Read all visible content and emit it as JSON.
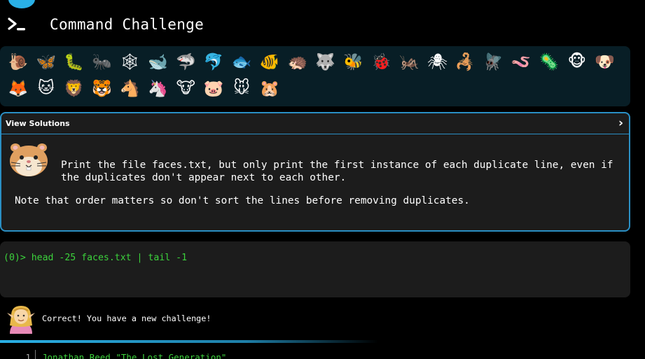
{
  "header": {
    "title": "Command Challenge"
  },
  "emoji_bar": {
    "items": [
      {
        "name": "snail",
        "glyph": "🐌"
      },
      {
        "name": "butterfly",
        "glyph": "🦋"
      },
      {
        "name": "caterpillar",
        "glyph": "🐛"
      },
      {
        "name": "ant",
        "glyph": "🐜"
      },
      {
        "name": "spider-web",
        "glyph": "🕸"
      },
      {
        "name": "whale",
        "glyph": "🐋"
      },
      {
        "name": "shark",
        "glyph": "🦈"
      },
      {
        "name": "dolphin",
        "glyph": "🐬"
      },
      {
        "name": "fish",
        "glyph": "🐟"
      },
      {
        "name": "tropical-fish",
        "glyph": "🐠"
      },
      {
        "name": "hedgehog",
        "glyph": "🦔"
      },
      {
        "name": "wolf",
        "glyph": "🐺"
      },
      {
        "name": "bee",
        "glyph": "🐝"
      },
      {
        "name": "ladybug",
        "glyph": "🐞"
      },
      {
        "name": "cricket",
        "glyph": "🦗"
      },
      {
        "name": "spider",
        "glyph": "🕷"
      },
      {
        "name": "scorpion",
        "glyph": "🦂"
      },
      {
        "name": "fly",
        "glyph": "🪰"
      },
      {
        "name": "worm",
        "glyph": "🪱"
      },
      {
        "name": "microbe",
        "glyph": "🦠"
      },
      {
        "name": "monkey",
        "glyph": "🐵"
      },
      {
        "name": "dog",
        "glyph": "🐶"
      },
      {
        "name": "fox",
        "glyph": "🦊"
      },
      {
        "name": "cat",
        "glyph": "🐱"
      },
      {
        "name": "lion",
        "glyph": "🦁"
      },
      {
        "name": "tiger",
        "glyph": "🐯"
      },
      {
        "name": "horse",
        "glyph": "🐴"
      },
      {
        "name": "unicorn",
        "glyph": "🦄"
      },
      {
        "name": "cow",
        "glyph": "🐮"
      },
      {
        "name": "pig",
        "glyph": "🐷"
      },
      {
        "name": "mouse",
        "glyph": "🐭"
      },
      {
        "name": "hamster",
        "glyph": "🐹"
      }
    ]
  },
  "challenge": {
    "header": "View Solutions",
    "text": "Print the file faces.txt, but only print the first instance of each duplicate line, even if the duplicates don't appear next to each other.",
    "note": "Note that order matters so don't sort the lines before removing duplicates."
  },
  "terminal": {
    "prompt": "(0)> ",
    "command": "head -25 faces.txt | tail -1"
  },
  "feedback": {
    "message": "Correct! You have a new challenge!"
  },
  "output": {
    "lines": [
      {
        "num": "1",
        "text": "Jonathan Reed \"The Lost Generation\""
      }
    ]
  },
  "colors": {
    "accent": "#2ab0e6",
    "terminal_green": "#3cd23c",
    "panel_bg": "#1c1c1c",
    "emoji_bar_bg": "#081e26"
  }
}
